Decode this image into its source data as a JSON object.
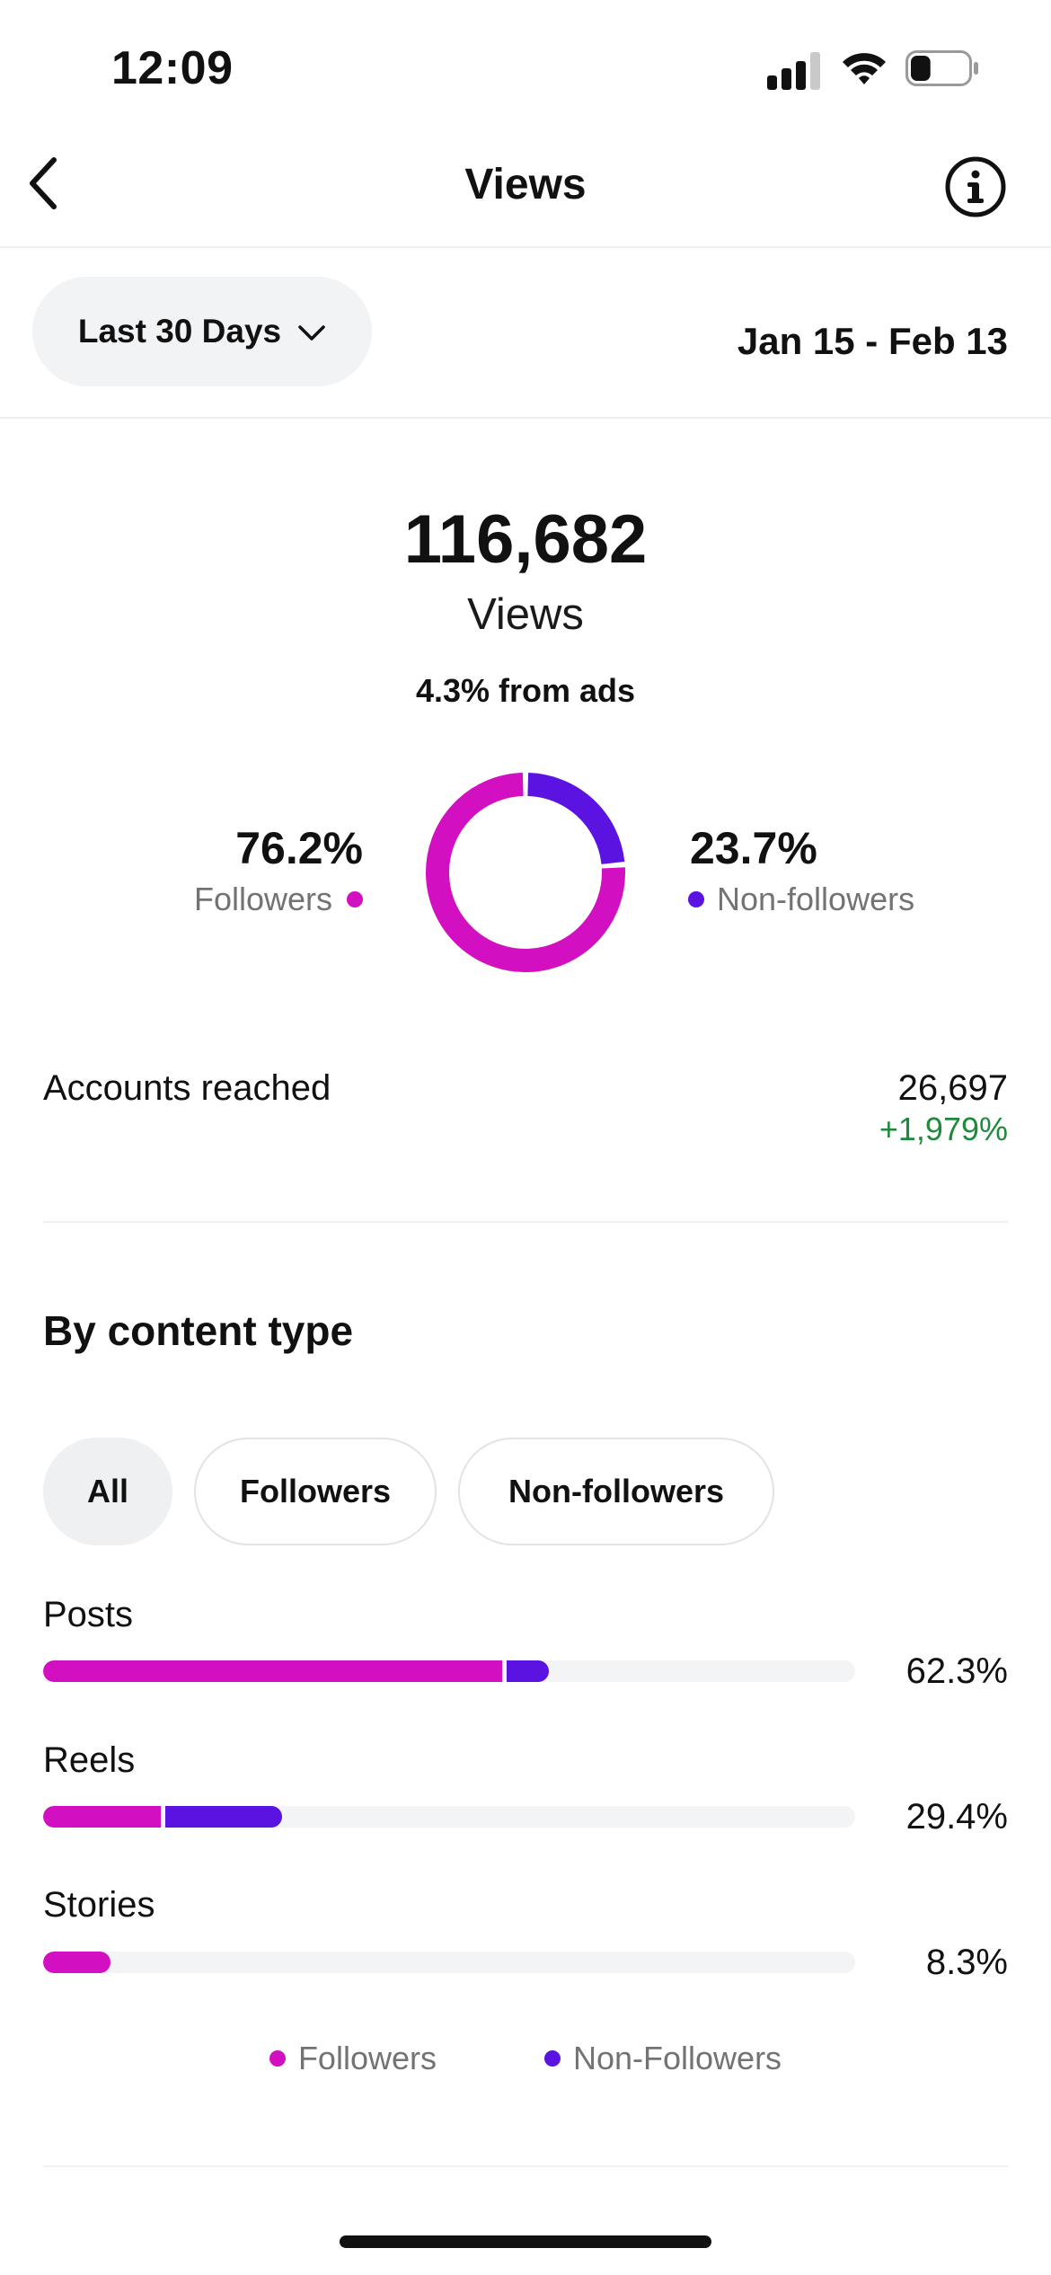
{
  "status_bar": {
    "time": "12:09",
    "signal_icon": "cellular-signal-icon",
    "wifi_icon": "wifi-icon",
    "battery_icon": "battery-icon",
    "battery_level": 0.35
  },
  "header": {
    "title": "Views",
    "back_icon": "chevron-left-icon",
    "info_icon": "info-icon"
  },
  "period": {
    "selected": "Last 30 Days",
    "dropdown_icon": "chevron-down-icon",
    "date_range": "Jan 15 - Feb 13"
  },
  "summary": {
    "total": "116,682",
    "label": "Views",
    "ads_note": "4.3% from ads"
  },
  "audience_split": {
    "followers_pct": "76.2%",
    "followers_label": "Followers",
    "nonfollowers_pct": "23.7%",
    "nonfollowers_label": "Non-followers",
    "followers_value": 76.2,
    "nonfollowers_value": 23.7
  },
  "accounts_reached": {
    "label": "Accounts reached",
    "value": "26,697",
    "change": "+1,979%"
  },
  "content_type": {
    "title": "By content type",
    "chips": [
      "All",
      "Followers",
      "Non-followers"
    ],
    "selected_chip": "All",
    "rows": [
      {
        "label": "Posts",
        "percent": "62.3%",
        "followers_fraction": 0.565,
        "nonfollowers_fraction": 0.058
      },
      {
        "label": "Reels",
        "percent": "29.4%",
        "followers_fraction": 0.145,
        "nonfollowers_fraction": 0.149
      },
      {
        "label": "Stories",
        "percent": "8.3%",
        "followers_fraction": 0.083,
        "nonfollowers_fraction": 0.0
      }
    ],
    "legend": {
      "followers": "Followers",
      "nonfollowers": "Non-Followers"
    }
  },
  "colors": {
    "followers": "#d20fc1",
    "nonfollowers": "#5a13e0",
    "track": "#f3f4f6",
    "positive_change": "#1f8a3b",
    "muted_text": "#737373"
  }
}
